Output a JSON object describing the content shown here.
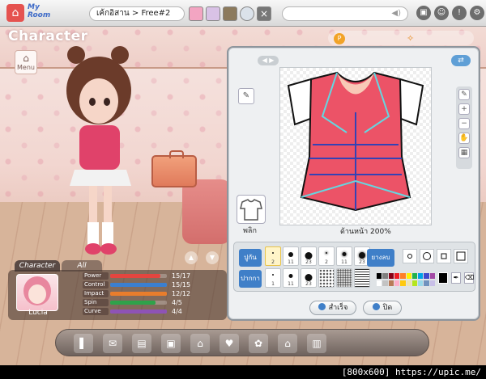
{
  "topbar": {
    "app_logo": "home-logo",
    "myroom_label": "My Room",
    "location": "เค้กอิสาน > Free#2",
    "message_placeholder": "",
    "right_icons": [
      "window-icon",
      "user-settings-icon",
      "info-icon",
      "gear-icon"
    ]
  },
  "character": {
    "section_title": "Character",
    "menu_label": "Menu"
  },
  "editor": {
    "canvas_caption": "ด้านหน้า  200%",
    "flip_label": "พลิก",
    "pen_label": "ปูกัน",
    "shape_label": "ยางลบ",
    "fill_label": "ปากกา",
    "pen_sizes": [
      {
        "size": "2",
        "selected": true
      },
      {
        "size": "11",
        "selected": false
      },
      {
        "size": "23",
        "selected": false
      },
      {
        "size": "2",
        "selected": false
      },
      {
        "size": "11",
        "selected": false
      },
      {
        "size": "23",
        "selected": false
      }
    ],
    "brush_sizes": [
      {
        "size": "1"
      },
      {
        "size": "11"
      },
      {
        "size": "23"
      },
      {
        "size": ""
      },
      {
        "size": ""
      },
      {
        "size": ""
      }
    ],
    "palette_colors": [
      "#000000",
      "#7f7f7f",
      "#880015",
      "#ed1c24",
      "#ff7f27",
      "#fff200",
      "#22b14c",
      "#00a2e8",
      "#3f48cc",
      "#a349a4",
      "#ffffff",
      "#c3c3c3",
      "#b97a57",
      "#ffaec9",
      "#ffc90e",
      "#efe4b0",
      "#b5e61d",
      "#99d9ea",
      "#7092be",
      "#c8bfe7"
    ],
    "current_color": "#000000",
    "save_button": "สำเร็จ",
    "close_button": "ปิด"
  },
  "stats": {
    "tab_character": "Character",
    "tab_all": "All",
    "character_name": "Lucia",
    "rows": [
      {
        "label": "Power",
        "value": "15/17",
        "fill": 0.88,
        "color": "#e4453f"
      },
      {
        "label": "Control",
        "value": "15/15",
        "fill": 1.0,
        "color": "#3b7fd0"
      },
      {
        "label": "Impact",
        "value": "12/12",
        "fill": 1.0,
        "color": "#e87d2c"
      },
      {
        "label": "Spin",
        "value": "4/5",
        "fill": 0.8,
        "color": "#2fa24a"
      },
      {
        "label": "Curve",
        "value": "4/4",
        "fill": 1.0,
        "color": "#8e53b5"
      }
    ]
  },
  "footer_text": "[800x600] https://upic.me/"
}
